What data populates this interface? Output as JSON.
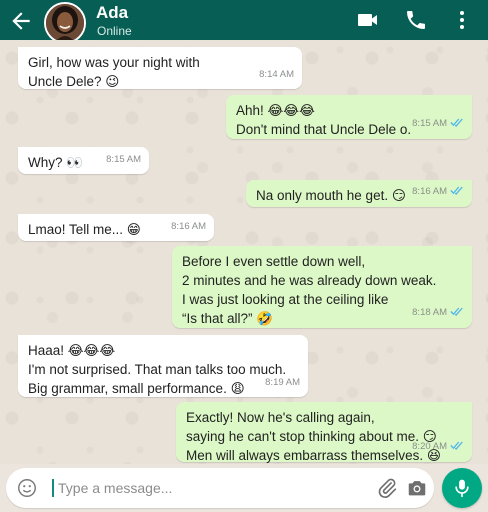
{
  "contact": {
    "name": "Ada",
    "status": "Online"
  },
  "header_icons": [
    "back-arrow-icon",
    "video-call-icon",
    "voice-call-icon",
    "more-options-icon"
  ],
  "messages": [
    {
      "direction": "in",
      "lines": [
        "Girl, how was your night with",
        "Uncle Dele? 😉"
      ],
      "time": "8:14 AM"
    },
    {
      "direction": "out",
      "lines": [
        "Ahh! 😂😂😂",
        "Don't mind that Uncle Dele o."
      ],
      "time": "8:15 AM",
      "read": true
    },
    {
      "direction": "in",
      "lines": [
        "Why? 👀"
      ],
      "time": "8:15 AM"
    },
    {
      "direction": "out",
      "lines": [
        "Na only mouth he get. 😏"
      ],
      "time": "8:16 AM",
      "read": true
    },
    {
      "direction": "in",
      "lines": [
        "Lmao! Tell me... 😁"
      ],
      "time": "8:16 AM"
    },
    {
      "direction": "out",
      "lines": [
        "Before I even settle down well,",
        "2 minutes and he was already down weak.",
        "I was just looking at the ceiling like",
        "“Is that all?” 🤣"
      ],
      "time": "8:18 AM",
      "read": true
    },
    {
      "direction": "in",
      "lines": [
        "Haaa! 😂😂😂",
        "I'm not surprised. That man talks too much.",
        "Big grammar, small performance. 😩"
      ],
      "time": "8:19 AM"
    },
    {
      "direction": "out",
      "lines": [
        "Exactly! Now he's calling again,",
        "saying he can't stop thinking about me. 😏",
        "Men will always embarrass themselves. 😆"
      ],
      "time": "8:20 AM",
      "read": true
    }
  ],
  "composer": {
    "placeholder": "Type a message..."
  },
  "colors": {
    "header": "#075e54",
    "outgoing_bubble": "#dcf8c6",
    "incoming_bubble": "#ffffff",
    "mic_button": "#00a884",
    "read_ticks": "#4fb6ec"
  }
}
